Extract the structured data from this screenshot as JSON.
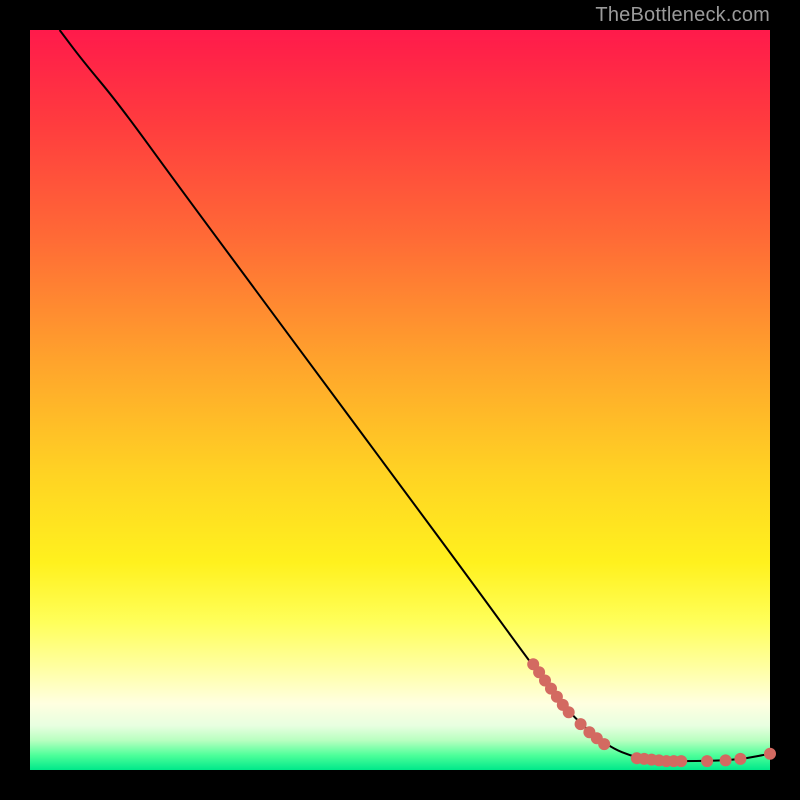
{
  "attribution": "TheBottleneck.com",
  "colors": {
    "marker": "#d36a61",
    "line": "#000000",
    "frame": "#000000"
  },
  "chart_data": {
    "type": "line",
    "title": "",
    "xlabel": "",
    "ylabel": "",
    "xlim": [
      0,
      100
    ],
    "ylim": [
      0,
      100
    ],
    "grid": false,
    "line_points": [
      {
        "x": 4,
        "y": 100
      },
      {
        "x": 7,
        "y": 96
      },
      {
        "x": 12,
        "y": 90
      },
      {
        "x": 20,
        "y": 79
      },
      {
        "x": 30,
        "y": 65.5
      },
      {
        "x": 40,
        "y": 52
      },
      {
        "x": 50,
        "y": 38.5
      },
      {
        "x": 60,
        "y": 25
      },
      {
        "x": 68,
        "y": 14
      },
      {
        "x": 73,
        "y": 7.5
      },
      {
        "x": 78,
        "y": 3.2
      },
      {
        "x": 82,
        "y": 1.6
      },
      {
        "x": 86,
        "y": 1.2
      },
      {
        "x": 90,
        "y": 1.2
      },
      {
        "x": 94,
        "y": 1.3
      },
      {
        "x": 97,
        "y": 1.6
      },
      {
        "x": 100,
        "y": 2.2
      }
    ],
    "markers": [
      {
        "x": 68.0,
        "y": 14.3
      },
      {
        "x": 68.8,
        "y": 13.2
      },
      {
        "x": 69.6,
        "y": 12.1
      },
      {
        "x": 70.4,
        "y": 11.0
      },
      {
        "x": 71.2,
        "y": 9.9
      },
      {
        "x": 72.0,
        "y": 8.8
      },
      {
        "x": 72.8,
        "y": 7.8
      },
      {
        "x": 74.4,
        "y": 6.2
      },
      {
        "x": 75.6,
        "y": 5.1
      },
      {
        "x": 76.6,
        "y": 4.3
      },
      {
        "x": 77.6,
        "y": 3.5
      },
      {
        "x": 82.0,
        "y": 1.6
      },
      {
        "x": 83.0,
        "y": 1.5
      },
      {
        "x": 84.0,
        "y": 1.4
      },
      {
        "x": 85.0,
        "y": 1.3
      },
      {
        "x": 86.0,
        "y": 1.2
      },
      {
        "x": 87.0,
        "y": 1.2
      },
      {
        "x": 88.0,
        "y": 1.2
      },
      {
        "x": 91.5,
        "y": 1.2
      },
      {
        "x": 94.0,
        "y": 1.3
      },
      {
        "x": 96.0,
        "y": 1.5
      },
      {
        "x": 100.0,
        "y": 2.2
      }
    ]
  }
}
